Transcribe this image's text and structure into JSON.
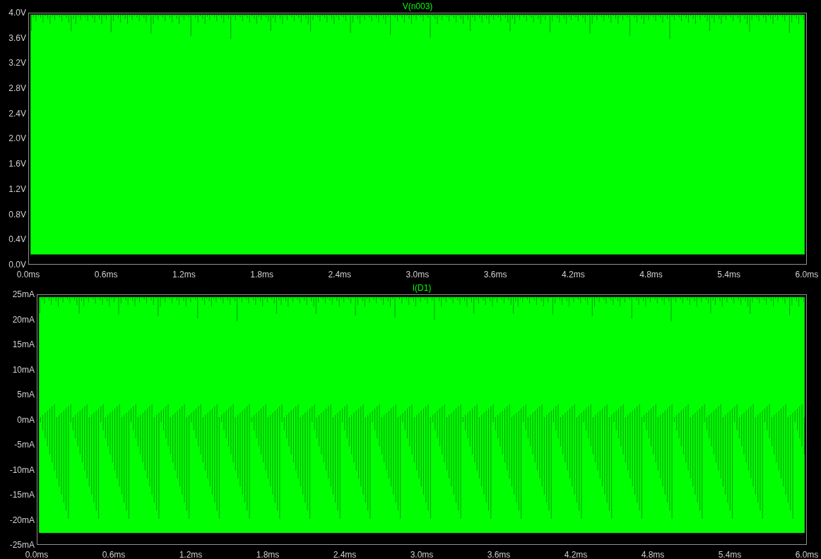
{
  "panes": [
    {
      "title": "V(n003)",
      "y_ticks": [
        "4.0V",
        "3.6V",
        "3.2V",
        "2.8V",
        "2.4V",
        "2.0V",
        "1.6V",
        "1.2V",
        "0.8V",
        "0.4V",
        "0.0V"
      ],
      "x_ticks": [
        "0.0ms",
        "0.6ms",
        "1.2ms",
        "1.8ms",
        "2.4ms",
        "3.0ms",
        "3.6ms",
        "4.2ms",
        "4.8ms",
        "5.4ms",
        "6.0ms"
      ]
    },
    {
      "title": "I(D1)",
      "y_ticks": [
        "25mA",
        "20mA",
        "15mA",
        "10mA",
        "5mA",
        "0mA",
        "-5mA",
        "-10mA",
        "-15mA",
        "-20mA",
        "-25mA"
      ],
      "x_ticks": [
        "0.0ms",
        "0.6ms",
        "1.2ms",
        "1.8ms",
        "2.4ms",
        "3.0ms",
        "3.6ms",
        "4.2ms",
        "4.8ms",
        "5.4ms",
        "6.0ms"
      ]
    }
  ]
}
